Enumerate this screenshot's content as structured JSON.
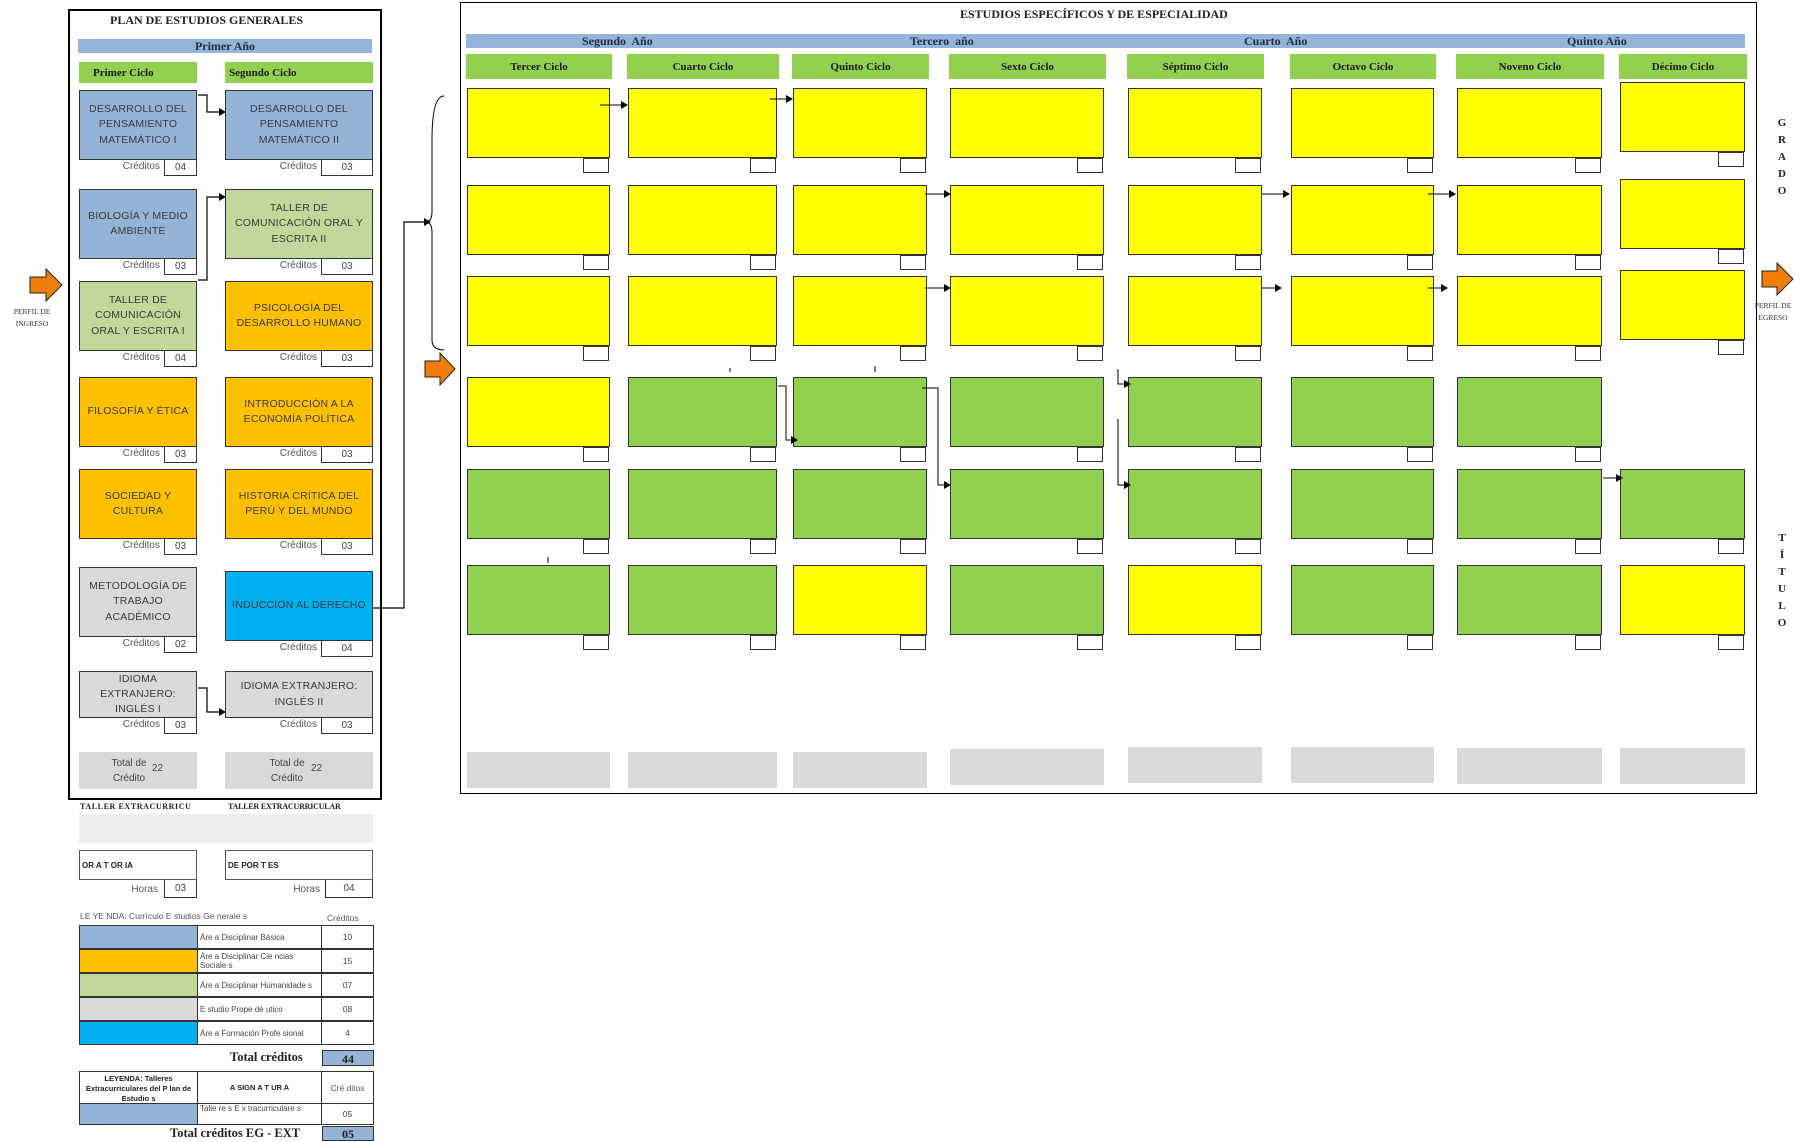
{
  "general": {
    "title": "PLAN DE ESTUDIOS GENERALES",
    "year": "Primer Año",
    "cycle1": "Primer Ciclo",
    "cycle2": "Segundo Ciclo",
    "credits_label": "Créditos",
    "courses_c1": [
      {
        "name": "DESARROLLO DEL PENSAMIENTO MATEMÁTICO  I",
        "credits": "04",
        "color": "#95b3d7"
      },
      {
        "name": "BIOLOGÍA Y MEDIO AMBIENTE",
        "credits": "03",
        "color": "#95b3d7"
      },
      {
        "name": "TALLER DE COMUNICACIÓN ORAL Y ESCRITA I",
        "credits": "04",
        "color": "#c4d79b"
      },
      {
        "name": "FILOSOFÍA Y ÉTICA",
        "credits": "03",
        "color": "#ffc000"
      },
      {
        "name": "SOCIEDAD Y CULTURA",
        "credits": "03",
        "color": "#ffc000"
      },
      {
        "name": "METODOLOGÍA DE TRABAJO ACADÉMICO",
        "credits": "02",
        "color": "#d9d9d9"
      },
      {
        "name": "IDIOMA EXTRANJERO: INGLÉS  I",
        "credits": "03",
        "color": "#d9d9d9"
      }
    ],
    "courses_c2": [
      {
        "name": "DESARROLLO DEL PENSAMIENTO MATEMÁTICO II",
        "credits": "03",
        "color": "#95b3d7"
      },
      {
        "name": "TALLER  DE COMUNICACIÓN ORAL Y ESCRITA  II",
        "credits": "03",
        "color": "#c4d79b"
      },
      {
        "name": "PSICOLOGÍA DEL DESARROLLO HUMANO",
        "credits": "03",
        "color": "#ffc000"
      },
      {
        "name": "INTRODUCCIÓN A LA ECONOMÍA POLÍTICA",
        "credits": "03",
        "color": "#ffc000"
      },
      {
        "name": "HISTORIA CRÍTICA DEL PERÚ Y DEL MUNDO",
        "credits": "03",
        "color": "#ffc000"
      },
      {
        "name": "INDUCCIÓN AL DERECHO",
        "credits": "04",
        "color": "#00b0f0"
      },
      {
        "name": "IDIOMA EXTRANJERO: INGLÉS II",
        "credits": "03",
        "color": "#d9d9d9"
      }
    ],
    "total_c1_label": "Total de Crédito",
    "total_c1_value": "22",
    "total_c2_label": "Total de Crédito",
    "total_c2_value": "22"
  },
  "entry": {
    "label_line1": "PERFIL DE",
    "label_line2": "INGRESO"
  },
  "exit": {
    "label_line1": "PERFIL DE",
    "label_line2": "EGRESO"
  },
  "extracurricular": {
    "header1": "TALLER EXTRACURRICU",
    "header2": "TALLER EXTRACURRICULAR",
    "item1": "OR A T OR IA",
    "item2": "DE POR T ES",
    "hours_label": "Horas",
    "hours1": "03",
    "hours2": "04"
  },
  "legend": {
    "title": "LE YE NDA: Currículo E studios Ge nerale s",
    "credits_header": "Créditos",
    "rows": [
      {
        "label": "Áre a Disciplinar Básica",
        "credits": "10",
        "color": "#95b3d7"
      },
      {
        "label": "Áre a Disciplinar Cie ncias Sociale s",
        "credits": "15",
        "color": "#ffc000"
      },
      {
        "label": "Áre a Disciplinar Humanidade s",
        "credits": "07",
        "color": "#c4d79b"
      },
      {
        "label": "E studio Prope dé utico",
        "credits": "08",
        "color": "#d9d9d9"
      },
      {
        "label": "Áre a Formación Profe sional",
        "credits": "4",
        "color": "#00b0f0"
      }
    ],
    "total_label": "Total créditos",
    "total_value": "44",
    "legend2_title": "LEYENDA: Talleres Extracurriculares del P lan de Estudio s",
    "legend2_col2": "A SIGN A T UR A",
    "legend2_col3": "Cré ditos",
    "legend2_row_label": "Talle re s E x tracurriculare s",
    "legend2_row_credits": "05",
    "grand_total_label": "Total créditos EG - EXT",
    "grand_total_value": "05"
  },
  "specific": {
    "title": "ESTUDIOS ESPECÍFICOS Y  DE ESPECIALIDAD",
    "years": [
      "Segundo  Año",
      "Tercero  año",
      "Cuarto  Año",
      "Quinto Año"
    ],
    "cycles": [
      "Tercer Ciclo",
      "Cuarto Ciclo",
      "Quinto Ciclo",
      "Sexto Ciclo",
      "Séptimo Ciclo",
      "Octavo Ciclo",
      "Noveno Ciclo",
      "Décimo Ciclo"
    ],
    "grid": [
      [
        "Y",
        "Y",
        "Y",
        "Y",
        "Y",
        "Y",
        "Y",
        "Y"
      ],
      [
        "Y",
        "Y",
        "Y",
        "Y",
        "Y",
        "Y",
        "Y",
        "Y"
      ],
      [
        "Y",
        "Y",
        "Y",
        "Y",
        "Y",
        "Y",
        "Y",
        "Y"
      ],
      [
        "Y",
        "G",
        "G",
        "G",
        "G",
        "G",
        "G",
        ""
      ],
      [
        "G",
        "G",
        "G",
        "G",
        "G",
        "G",
        "G",
        "G"
      ],
      [
        "G",
        "G",
        "Y",
        "G",
        "Y",
        "G",
        "G",
        "Y"
      ]
    ],
    "colors": {
      "Y": "#ffff00",
      "G": "#92d050"
    }
  },
  "side_right": {
    "grado": [
      "G",
      "R",
      "A",
      "D",
      "O"
    ],
    "titulo": [
      "T",
      "Í",
      "T",
      "U",
      "L",
      "O"
    ]
  }
}
